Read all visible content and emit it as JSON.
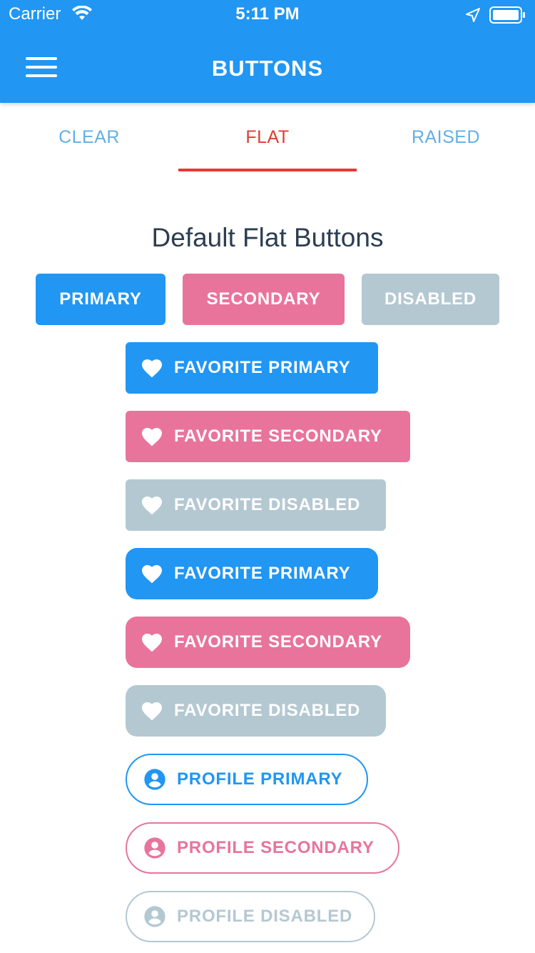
{
  "status_bar": {
    "carrier": "Carrier",
    "time": "5:11 PM"
  },
  "header": {
    "title": "BUTTONS",
    "color": "#2196f3"
  },
  "tabs": [
    {
      "label": "CLEAR"
    },
    {
      "label": "FLAT"
    },
    {
      "label": "RAISED"
    }
  ],
  "active_tab": "FLAT",
  "section_title": "Default Flat Buttons",
  "basic_buttons": {
    "primary": "PRIMARY",
    "secondary": "SECONDARY",
    "disabled": "DISABLED"
  },
  "favorite_buttons": [
    {
      "label": "FAVORITE PRIMARY",
      "variant": "primary",
      "icon": "heart-icon"
    },
    {
      "label": "FAVORITE SECONDARY",
      "variant": "secondary",
      "icon": "heart-icon"
    },
    {
      "label": "FAVORITE DISABLED",
      "variant": "disabled",
      "icon": "heart-icon"
    },
    {
      "label": "FAVORITE PRIMARY",
      "variant": "primary",
      "icon": "heart-icon"
    },
    {
      "label": "FAVORITE SECONDARY",
      "variant": "secondary",
      "icon": "heart-icon"
    },
    {
      "label": "FAVORITE DISABLED",
      "variant": "disabled",
      "icon": "heart-icon"
    }
  ],
  "profile_buttons": [
    {
      "label": "PROFILE PRIMARY",
      "variant": "primary",
      "icon": "account-circle-icon"
    },
    {
      "label": "PROFILE SECONDARY",
      "variant": "secondary",
      "icon": "account-circle-icon"
    },
    {
      "label": "PROFILE DISABLED",
      "variant": "disabled",
      "icon": "account-circle-icon"
    }
  ],
  "colors": {
    "primary": "#2196f3",
    "secondary": "#e8749c",
    "disabled": "#b4c8d2",
    "active_tab": "#e53935",
    "inactive_tab": "#64aee6"
  }
}
